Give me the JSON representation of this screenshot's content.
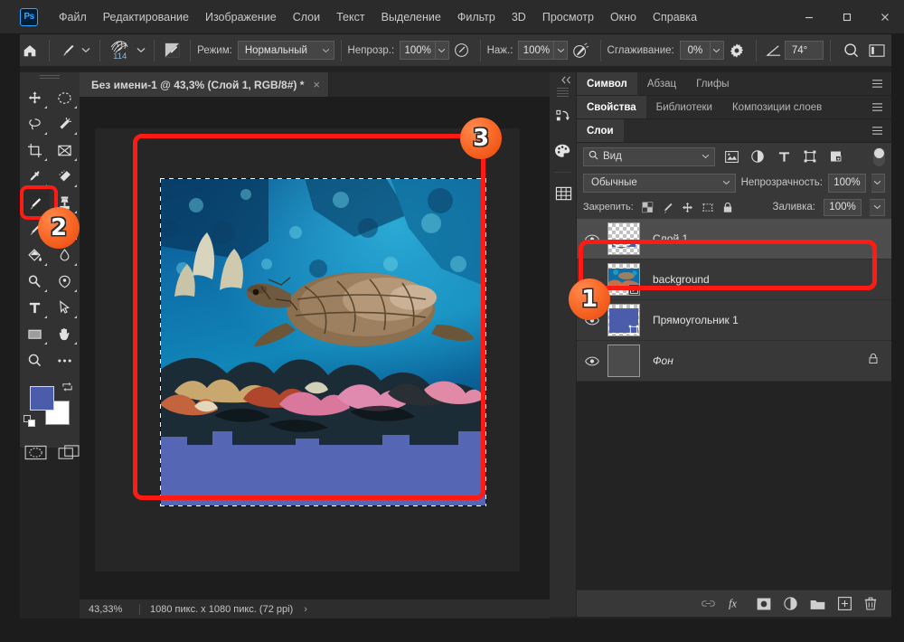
{
  "app": {
    "logo": "Ps",
    "title_tab": "Без имени-1 @ 43,3% (Слой 1, RGB/8#) *"
  },
  "menubar": {
    "items": [
      {
        "label": "Файл"
      },
      {
        "label": "Редактирование"
      },
      {
        "label": "Изображение"
      },
      {
        "label": "Слои"
      },
      {
        "label": "Текст"
      },
      {
        "label": "Выделение"
      },
      {
        "label": "Фильтр"
      },
      {
        "label": "3D"
      },
      {
        "label": "Просмотр"
      },
      {
        "label": "Окно"
      },
      {
        "label": "Справка"
      }
    ],
    "window_controls": {
      "minimize": "minimize-icon",
      "maximize": "maximize-icon",
      "close": "close-icon"
    }
  },
  "options_bar": {
    "home_icon": "home-icon",
    "tool_icon": "brush-tool-icon",
    "brush_preset_icon": "brush-tip-icon",
    "brush_size": "114",
    "brush_panel_icon": "brush-settings-panel-icon",
    "mode_label": "Режим:",
    "mode_value": "Нормальный",
    "opacity_label": "Непрозр.:",
    "opacity_value": "100%",
    "pressure_opacity_icon": "pressure-controls-opacity-icon",
    "flow_label": "Нажм.:",
    "flow_value": "100%",
    "airbrush_icon": "airbrush-icon",
    "smoothing_label": "Сглаживание:",
    "smoothing_value": "0%",
    "smoothing_options_icon": "gear-icon",
    "angle_icon": "brush-angle-icon",
    "angle_value": "74°",
    "pressure_size_icon": "pressure-controls-size-icon",
    "symmetry_icon": "symmetry-icon"
  },
  "options_bar_labels": {
    "flow_label_exact": "Наж.:"
  },
  "toolbar": {
    "tools": [
      {
        "name": "move-tool",
        "icon": "move-icon"
      },
      {
        "name": "elliptical-marquee-tool",
        "icon": "ellipse-marquee-icon"
      },
      {
        "name": "lasso-tool",
        "icon": "lasso-icon"
      },
      {
        "name": "magic-wand-tool",
        "icon": "magic-wand-icon"
      },
      {
        "name": "crop-tool",
        "icon": "crop-icon"
      },
      {
        "name": "frame-tool",
        "icon": "frame-icon"
      },
      {
        "name": "eyedropper-tool",
        "icon": "eyedropper-icon"
      },
      {
        "name": "spot-healing-brush-tool",
        "icon": "healing-brush-icon"
      },
      {
        "name": "brush-tool",
        "icon": "brush-icon",
        "selected": true
      },
      {
        "name": "clone-stamp-tool",
        "icon": "clone-stamp-icon"
      },
      {
        "name": "history-brush-tool",
        "icon": "history-brush-icon"
      },
      {
        "name": "eraser-tool",
        "icon": "eraser-icon"
      },
      {
        "name": "gradient-tool",
        "icon": "paint-bucket-icon"
      },
      {
        "name": "blur-tool",
        "icon": "blur-drop-icon"
      },
      {
        "name": "dodge-tool",
        "icon": "dodge-icon"
      },
      {
        "name": "pen-tool",
        "icon": "pen-icon"
      },
      {
        "name": "type-tool",
        "icon": "type-icon"
      },
      {
        "name": "path-selection-tool",
        "icon": "path-arrow-icon"
      },
      {
        "name": "rectangle-tool",
        "icon": "rectangle-icon"
      },
      {
        "name": "hand-tool",
        "icon": "hand-icon"
      },
      {
        "name": "zoom-tool",
        "icon": "zoom-icon"
      },
      {
        "name": "edit-toolbar",
        "icon": "ellipsis-icon"
      }
    ],
    "foreground_color": "#4a5caa",
    "background_color": "#ffffff",
    "swap_icon": "swap-colors-icon",
    "default_colors_icon": "default-colors-icon",
    "quick_mask_icon": "quick-mask-icon",
    "screen_mode_icon": "screen-mode-icon"
  },
  "status_bar": {
    "zoom": "43,33%",
    "doc_info": "1080 пикс. х 1080 пикс. (72 ppi)",
    "arrow": "›"
  },
  "rail": {
    "collapse_icon": "collapse-panels-icon",
    "icons": [
      {
        "name": "actions-panel-icon"
      },
      {
        "name": "swatches-panel-icon"
      },
      {
        "name": "patterns-panel-icon"
      }
    ]
  },
  "panels": {
    "group_character": {
      "tabs": [
        {
          "label": "Символ",
          "active": true
        },
        {
          "label": "Абзац",
          "active": false
        },
        {
          "label": "Глифы",
          "active": false
        }
      ],
      "menu_icon": "panel-menu-icon"
    },
    "group_properties": {
      "tabs": [
        {
          "label": "Свойства",
          "active": true
        },
        {
          "label": "Библиотеки",
          "active": false
        },
        {
          "label": "Композиции слоев",
          "active": false
        }
      ],
      "menu_icon": "panel-menu-icon"
    },
    "group_layers": {
      "tabs": [
        {
          "label": "Слои",
          "active": true
        }
      ],
      "menu_icon": "panel-menu-icon"
    }
  },
  "layers_panel": {
    "filter": {
      "search_icon": "search-icon",
      "value": "Вид",
      "caret": "chevron-down-icon",
      "type_icons": [
        {
          "name": "filter-pixel-icon"
        },
        {
          "name": "filter-adjustment-icon"
        },
        {
          "name": "filter-type-icon"
        },
        {
          "name": "filter-shape-icon"
        },
        {
          "name": "filter-smart-object-icon"
        }
      ],
      "toggle": "filter-enable-toggle"
    },
    "blend_mode": "Обычные",
    "opacity_label": "Непрозрачность:",
    "opacity_value": "100%",
    "lock_label": "Закрепить:",
    "lock_icons": [
      {
        "name": "lock-transparent-pixels-icon"
      },
      {
        "name": "lock-image-pixels-icon"
      },
      {
        "name": "lock-position-icon"
      },
      {
        "name": "lock-artboard-nesting-icon"
      },
      {
        "name": "lock-all-icon"
      }
    ],
    "fill_label": "Заливка:",
    "fill_value": "100%",
    "rows": [
      {
        "name": "Слой 1",
        "visible": true,
        "selected": true,
        "italic": false,
        "locked": false,
        "thumb": "transparent-with-blue-stroke"
      },
      {
        "name": "background",
        "visible": false,
        "selected": false,
        "italic": false,
        "locked": false,
        "thumb": "reef-photo",
        "badge": "smart-object-badge"
      },
      {
        "name": "Прямоугольник 1",
        "visible": true,
        "selected": false,
        "italic": false,
        "locked": false,
        "thumb": "blue-rectangle",
        "badge": "vector-mask-badge"
      },
      {
        "name": "Фон",
        "visible": true,
        "selected": false,
        "italic": true,
        "locked": true,
        "thumb": "solid-grey"
      }
    ],
    "footer_icons": [
      {
        "name": "link-layers-icon",
        "glyph": "link"
      },
      {
        "name": "layer-style-fx-icon",
        "glyph": "fx"
      },
      {
        "name": "add-layer-mask-icon",
        "glyph": "mask"
      },
      {
        "name": "new-adjustment-layer-icon",
        "glyph": "adjust"
      },
      {
        "name": "new-group-icon",
        "glyph": "folder"
      },
      {
        "name": "new-layer-icon",
        "glyph": "plus"
      },
      {
        "name": "delete-layer-icon",
        "glyph": "trash"
      }
    ]
  },
  "annotations": {
    "highlight_color": "#ff1a14",
    "badges": [
      {
        "number": "1",
        "target": "layer-row-sloy-1"
      },
      {
        "number": "2",
        "target": "brush-tool"
      },
      {
        "number": "3",
        "target": "canvas-selection"
      }
    ]
  },
  "canvas": {
    "selection": "marching-ants-rectangle",
    "layer_fill_color": "#5466b4",
    "image_subject": "coral-reef-with-sea-turtle"
  }
}
